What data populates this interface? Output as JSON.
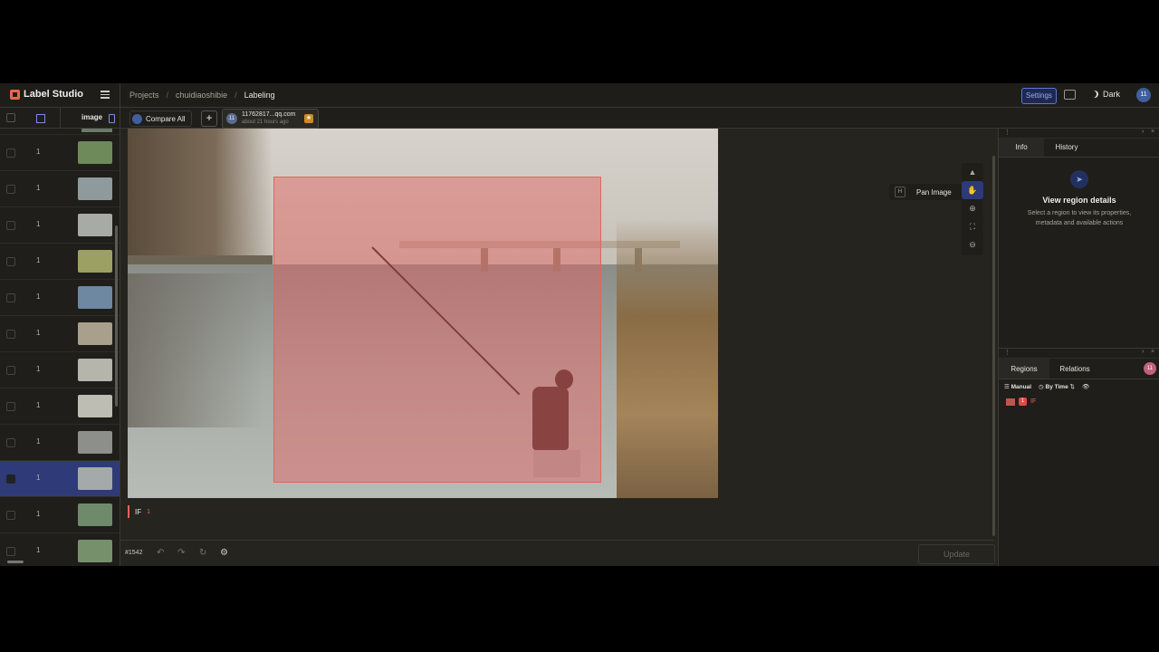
{
  "header": {
    "app_name": "Label Studio",
    "breadcrumb": [
      "Projects",
      "chuidiaoshibie",
      "Labeling"
    ],
    "settings_label": "Settings",
    "theme_label": "Dark",
    "user_initials": "11"
  },
  "left_panel": {
    "column_label": "image",
    "rows": [
      {
        "count": "1",
        "thumb": "#6f8a5a",
        "selected": false
      },
      {
        "count": "1",
        "thumb": "#8e9a9c",
        "selected": false
      },
      {
        "count": "1",
        "thumb": "#a8aaa5",
        "selected": false
      },
      {
        "count": "1",
        "thumb": "#9da063",
        "selected": false
      },
      {
        "count": "1",
        "thumb": "#6d88a0",
        "selected": false
      },
      {
        "count": "1",
        "thumb": "#a8a08c",
        "selected": false
      },
      {
        "count": "1",
        "thumb": "#b5b5ac",
        "selected": false
      },
      {
        "count": "1",
        "thumb": "#bdbdb3",
        "selected": false
      },
      {
        "count": "1",
        "thumb": "#8d8f8a",
        "selected": false
      },
      {
        "count": "1",
        "thumb": "#a4a9a9",
        "selected": true
      },
      {
        "count": "1",
        "thumb": "#6f8a6a",
        "selected": false
      },
      {
        "count": "1",
        "thumb": "#76906c",
        "selected": false
      }
    ]
  },
  "tabs": {
    "compare_label": "Compare All",
    "add_label": "+",
    "annotation": {
      "avatar": "11",
      "email": "11762817...qq.com",
      "time": "about 21 hours ago"
    }
  },
  "canvas": {
    "region_tag_label": "IF",
    "region_tag_count": "1",
    "tool_hint_key": "H",
    "tool_hint_label": "Pan Image"
  },
  "bottom_bar": {
    "task_id": "#1542",
    "update_label": "Update"
  },
  "info_panel": {
    "tab_info": "Info",
    "tab_history": "History",
    "title": "View region details",
    "description": "Select a region to view its properties, metadata and available actions"
  },
  "regions_panel": {
    "tab_regions": "Regions",
    "tab_relations": "Relations",
    "manual_label": "Manual",
    "by_time_label": "By Time",
    "avatar": "11",
    "items": [
      {
        "index": "1",
        "label": "IF"
      }
    ]
  },
  "colors": {
    "accent": "#5877d8",
    "region": "#e5645a",
    "selected_row": "#2f3b78"
  }
}
